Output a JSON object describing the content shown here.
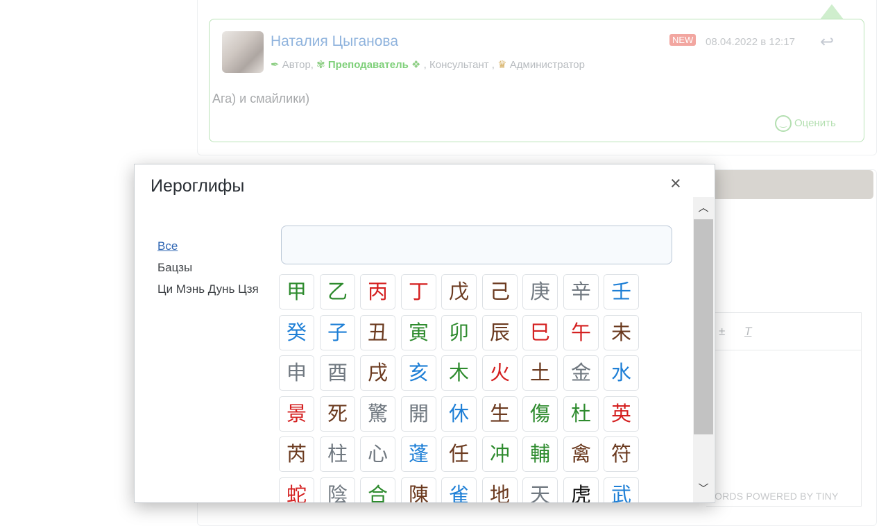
{
  "comment": {
    "author": "Наталия Цыганова",
    "roles": [
      {
        "icon": "feather-icon",
        "label": "Автор,",
        "style": "normal"
      },
      {
        "icon": "teacher-icon",
        "label": "Преподаватель",
        "style": "teacher"
      },
      {
        "icon": "consultant-icon",
        "label": ", Консультант ,",
        "style": "normal"
      },
      {
        "icon": "crown-icon",
        "label": "Администратор",
        "style": "normal"
      }
    ],
    "badge": "NEW",
    "date": "08.04.2022 в 12:17",
    "text": "Ага) и смайлики)",
    "rate_label": "Оценить"
  },
  "editor": {
    "powered_by": "ORDS  POWERED BY TINY"
  },
  "modal": {
    "title": "Иероглифы",
    "close_label": "×",
    "nav": [
      "Все",
      "Бацзы",
      "Ци Мэнь Дунь Цзя"
    ],
    "active_nav": "Все",
    "search_placeholder": "",
    "search_value": "",
    "characters": [
      {
        "char": "甲",
        "color": "#2e8b2e"
      },
      {
        "char": "乙",
        "color": "#2e8b2e"
      },
      {
        "char": "丙",
        "color": "#d42020"
      },
      {
        "char": "丁",
        "color": "#d42020"
      },
      {
        "char": "戊",
        "color": "#6b3a1f"
      },
      {
        "char": "己",
        "color": "#6b3a1f"
      },
      {
        "char": "庚",
        "color": "#707880"
      },
      {
        "char": "辛",
        "color": "#707880"
      },
      {
        "char": "壬",
        "color": "#1e7fd6"
      },
      {
        "char": "癸",
        "color": "#1e7fd6"
      },
      {
        "char": "子",
        "color": "#1e7fd6"
      },
      {
        "char": "丑",
        "color": "#6b3a1f"
      },
      {
        "char": "寅",
        "color": "#2e8b2e"
      },
      {
        "char": "卯",
        "color": "#2e8b2e"
      },
      {
        "char": "辰",
        "color": "#6b3a1f"
      },
      {
        "char": "巳",
        "color": "#d42020"
      },
      {
        "char": "午",
        "color": "#d42020"
      },
      {
        "char": "未",
        "color": "#6b3a1f"
      },
      {
        "char": "申",
        "color": "#707880"
      },
      {
        "char": "酉",
        "color": "#707880"
      },
      {
        "char": "戌",
        "color": "#6b3a1f"
      },
      {
        "char": "亥",
        "color": "#1e7fd6"
      },
      {
        "char": "木",
        "color": "#2e8b2e"
      },
      {
        "char": "火",
        "color": "#d42020"
      },
      {
        "char": "土",
        "color": "#6b3a1f"
      },
      {
        "char": "金",
        "color": "#707880"
      },
      {
        "char": "水",
        "color": "#1e7fd6"
      },
      {
        "char": "景",
        "color": "#d42020"
      },
      {
        "char": "死",
        "color": "#6b3a1f"
      },
      {
        "char": "驚",
        "color": "#707880"
      },
      {
        "char": "開",
        "color": "#707880"
      },
      {
        "char": "休",
        "color": "#1e7fd6"
      },
      {
        "char": "生",
        "color": "#6b3a1f"
      },
      {
        "char": "傷",
        "color": "#2e8b2e"
      },
      {
        "char": "杜",
        "color": "#2e8b2e"
      },
      {
        "char": "英",
        "color": "#d42020"
      },
      {
        "char": "芮",
        "color": "#6b3a1f"
      },
      {
        "char": "柱",
        "color": "#707880"
      },
      {
        "char": "心",
        "color": "#707880"
      },
      {
        "char": "蓬",
        "color": "#1e7fd6"
      },
      {
        "char": "任",
        "color": "#6b3a1f"
      },
      {
        "char": "冲",
        "color": "#2e8b2e"
      },
      {
        "char": "輔",
        "color": "#2e8b2e"
      },
      {
        "char": "禽",
        "color": "#6b3a1f"
      },
      {
        "char": "符",
        "color": "#6b3a1f"
      },
      {
        "char": "蛇",
        "color": "#d42020"
      },
      {
        "char": "陰",
        "color": "#707880"
      },
      {
        "char": "合",
        "color": "#2e8b2e"
      },
      {
        "char": "陳",
        "color": "#6b3a1f"
      },
      {
        "char": "雀",
        "color": "#1e7fd6"
      },
      {
        "char": "地",
        "color": "#6b3a1f"
      },
      {
        "char": "天",
        "color": "#707880"
      },
      {
        "char": "虎",
        "color": "#111111"
      },
      {
        "char": "武",
        "color": "#1e7fd6"
      }
    ]
  }
}
